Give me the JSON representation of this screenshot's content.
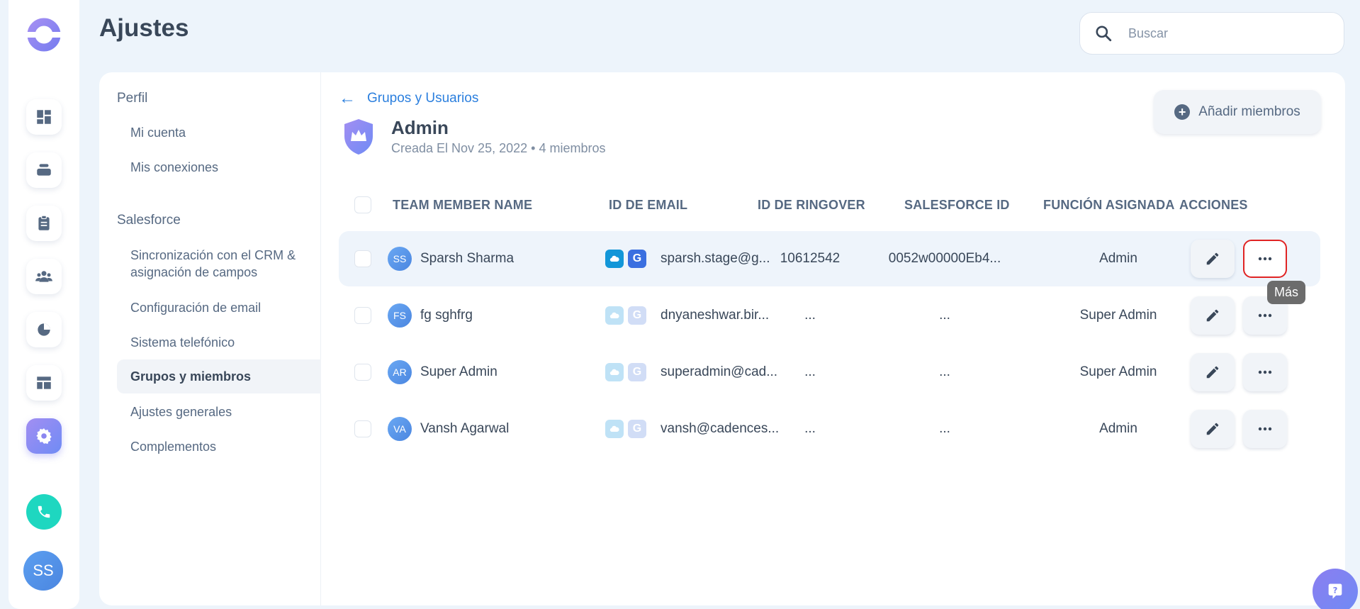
{
  "page_title": "Ajustes",
  "search": {
    "placeholder": "Buscar"
  },
  "settings_nav": {
    "sections": [
      {
        "title": "Perfil",
        "items": [
          "Mi cuenta",
          "Mis conexiones"
        ]
      },
      {
        "title": "Salesforce",
        "items": [
          "Sincronización con el CRM & asignación de campos",
          "Configuración de email",
          "Sistema telefónico",
          "Grupos y miembros",
          "Ajustes generales",
          "Complementos"
        ]
      }
    ],
    "active_item": "Grupos y miembros"
  },
  "back_link": "Grupos y Usuarios",
  "group": {
    "name": "Admin",
    "created": "Creada El Nov 25, 2022",
    "members_count": "4 miembros"
  },
  "add_button": "Añadir miembros",
  "table": {
    "headers": [
      "TEAM MEMBER NAME",
      "ID DE EMAIL",
      "ID DE RINGOVER",
      "SALESFORCE ID",
      "FUNCIÓN ASIGNADA",
      "ACCIONES"
    ],
    "rows": [
      {
        "initials": "SS",
        "name": "Sparsh Sharma",
        "email": "sparsh.stage@g...",
        "ringover_id": "10612542",
        "salesforce_id": "0052w00000Eb4...",
        "role": "Admin",
        "integrations_connected": true
      },
      {
        "initials": "FS",
        "name": "fg sghfrg",
        "email": "dnyaneshwar.bir...",
        "ringover_id": "...",
        "salesforce_id": "...",
        "role": "Super Admin",
        "integrations_connected": false
      },
      {
        "initials": "AR",
        "name": "Super Admin",
        "email": "superadmin@cad...",
        "ringover_id": "...",
        "salesforce_id": "...",
        "role": "Super Admin",
        "integrations_connected": false
      },
      {
        "initials": "VA",
        "name": "Vansh Agarwal",
        "email": "vansh@cadences...",
        "ringover_id": "...",
        "salesforce_id": "...",
        "role": "Admin",
        "integrations_connected": false
      }
    ]
  },
  "tooltip": "Más",
  "user_avatar": "SS",
  "colors": {
    "accent": "#2b7fde",
    "brand_purple": "#8b7ef0",
    "call_green": "#1ed7c0",
    "highlight_red": "#e02424"
  }
}
